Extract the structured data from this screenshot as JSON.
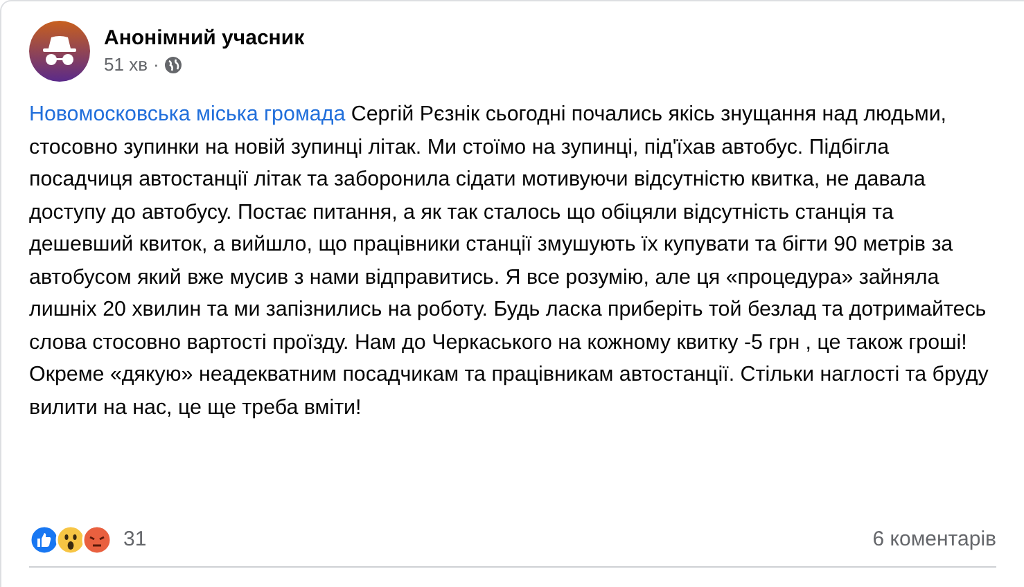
{
  "post": {
    "author": "Анонімний учасник",
    "time": "51 хв",
    "separator": "·",
    "group_link": "Новомосковська міська громада",
    "text": "Сергій Рєзнік  сьогодні почались якісь знущання над людьми, стосовно зупинки на новій зупинці літак. Ми стоїмо на зупинці, під'їхав автобус.  Підбігла посадчиця автостанції літак та заборонила сідати мотивуючи відсутністю квитка, не давала доступу до автобусу. Постає питання, а як так сталось що обіцяли відсутність станція та дешевший квиток, а вийшло, що працівники станції змушують їх купувати та бігти 90 метрів за автобусом який вже мусив з нами відправитись. Я все розумію, але ця «процедура» зайняла лишніх 20 хвилин та ми запізнились на роботу. Будь ласка приберіть той безлад та дотримайтесь слова стосовно вартості проїзду. Нам до Черкаського на кожному квитку -5 грн , це також гроші! Окреме «дякую» неадекватним посадчикам та працівникам автостанції. Стільки наглості та бруду вилити на нас, це ще треба вміти!",
    "reaction_count": "31",
    "comments": "6 коментарів"
  }
}
